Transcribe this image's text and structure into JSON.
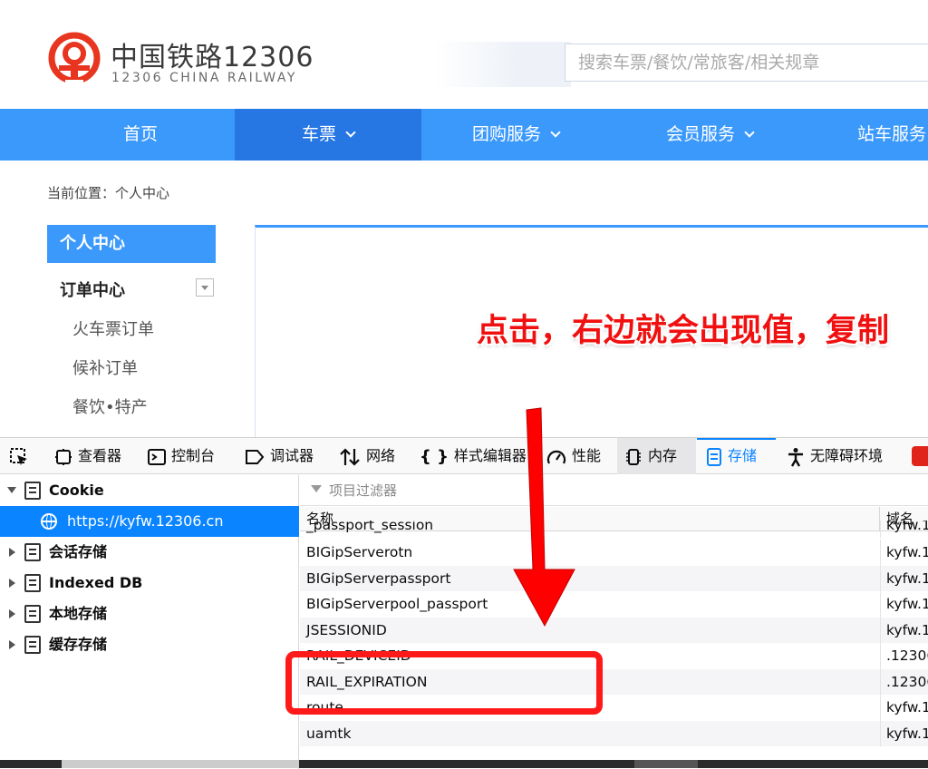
{
  "header": {
    "logo_cn": "中国铁路12306",
    "logo_en": "12306 CHINA RAILWAY",
    "search_placeholder": "搜索车票/餐饮/常旅客/相关规章"
  },
  "nav": {
    "items": [
      {
        "label": "首页"
      },
      {
        "label": "车票"
      },
      {
        "label": "团购服务"
      },
      {
        "label": "会员服务"
      },
      {
        "label": "站车服务"
      }
    ]
  },
  "breadcrumb": "当前位置：个人中心",
  "sidebar": {
    "active": "个人中心",
    "group": "订单中心",
    "items": [
      "火车票订单",
      "候补订单",
      "餐饮•特产"
    ]
  },
  "annotation": "点击，右边就会出现值，复制",
  "devtools": {
    "tabs": [
      "查看器",
      "控制台",
      "调试器",
      "网络",
      "样式编辑器",
      "性能",
      "内存",
      "存储",
      "无障碍环境"
    ],
    "tree": {
      "cookie": "Cookie",
      "cookie_url": "https://kyfw.12306.cn",
      "session": "会话存储",
      "indexed": "Indexed DB",
      "local": "本地存储",
      "cache": "缓存存储"
    },
    "filter_placeholder": "项目过滤器",
    "columns": {
      "name": "名称",
      "domain": "域名"
    },
    "rows": [
      {
        "name": "_passport_session",
        "domain": "kyfw.1"
      },
      {
        "name": "BIGipServerotn",
        "domain": "kyfw.1"
      },
      {
        "name": "BIGipServerpassport",
        "domain": "kyfw.1"
      },
      {
        "name": "BIGipServerpool_passport",
        "domain": "kyfw.1"
      },
      {
        "name": "JSESSIONID",
        "domain": "kyfw.1"
      },
      {
        "name": "RAIL_DEVICEID",
        "domain": ".12306"
      },
      {
        "name": "RAIL_EXPIRATION",
        "domain": ".12306"
      },
      {
        "name": "route",
        "domain": "kyfw.1"
      },
      {
        "name": "uamtk",
        "domain": "kyfw.1"
      }
    ]
  },
  "colors": {
    "brand_blue": "#3b99fc",
    "nav_active": "#2676e3",
    "logo_red": "#e8351f",
    "annotation_red": "#f01010",
    "devtools_accent": "#0a84ff"
  }
}
